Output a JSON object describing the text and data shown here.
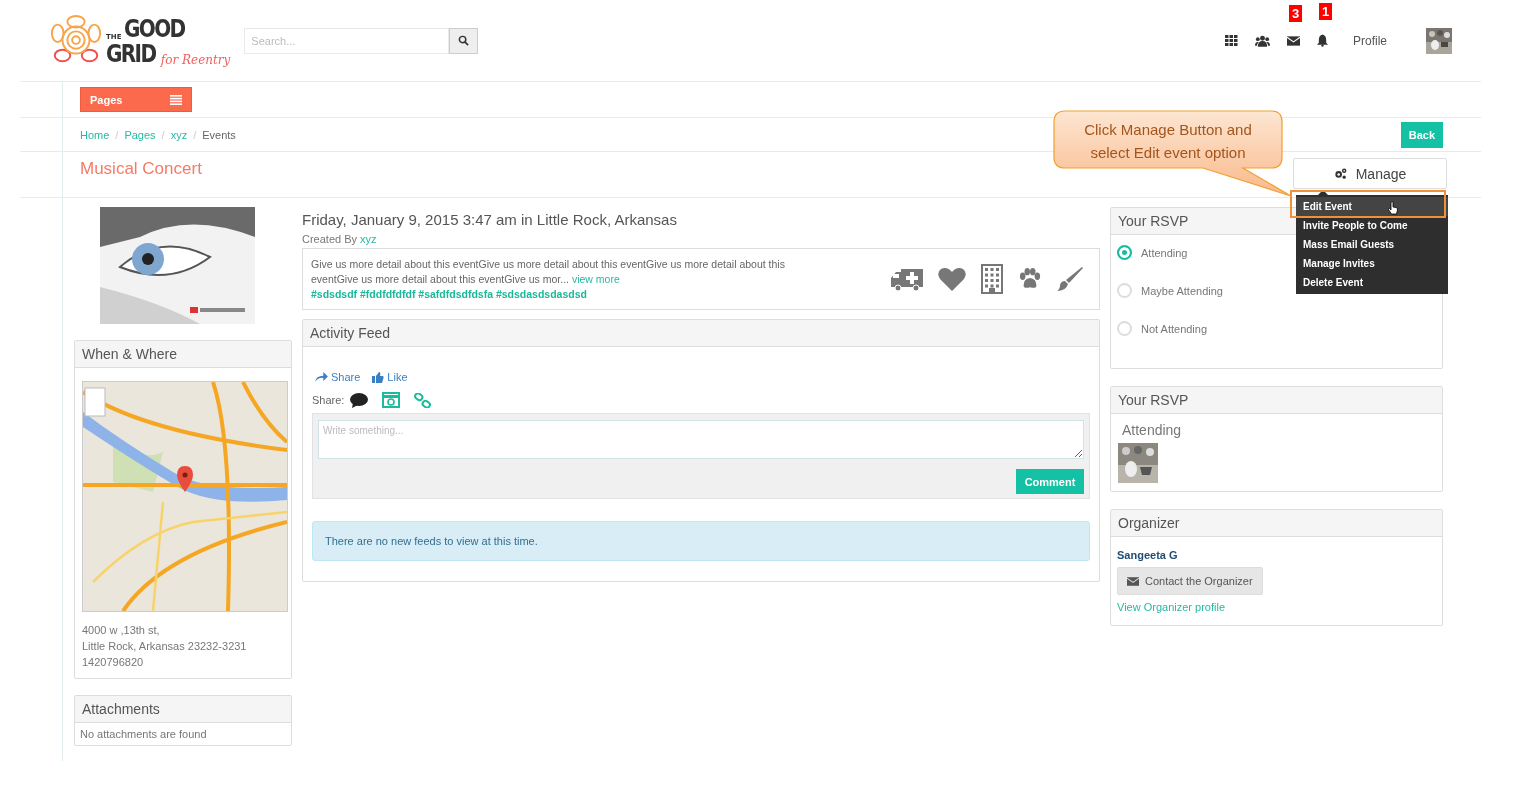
{
  "logo": {
    "the": "THE",
    "good": "GOOD",
    "grid": "GRID",
    "tagline": "for Reentry"
  },
  "search": {
    "placeholder": "Search..."
  },
  "nav_icons": [
    {
      "kind": "grid"
    },
    {
      "kind": "users"
    },
    {
      "kind": "mail",
      "badge": "3"
    },
    {
      "kind": "bell",
      "badge": "1"
    }
  ],
  "profile": {
    "label": "Profile"
  },
  "pages_button": {
    "label": "Pages"
  },
  "breadcrumb": [
    {
      "label": "Home",
      "current": false,
      "separator": "/"
    },
    {
      "label": "Pages",
      "current": false,
      "separator": "/"
    },
    {
      "label": "xyz",
      "current": false,
      "separator": "/"
    },
    {
      "label": "Events",
      "current": true
    }
  ],
  "back_button": {
    "label": "Back"
  },
  "page_title": "Musical Concert",
  "callout": {
    "text": "Click Manage Button and select Edit event option"
  },
  "manage": {
    "label": "Manage",
    "menu": [
      {
        "label": "Edit Event",
        "selected": true
      },
      {
        "label": "Invite People to Come",
        "selected": false
      },
      {
        "label": "Mass Email Guests",
        "selected": false
      },
      {
        "label": "Manage Invites",
        "selected": false
      },
      {
        "label": "Delete Event",
        "selected": false
      }
    ]
  },
  "event": {
    "datetime": "Friday, January 9, 2015 3:47 am in Little Rock, Arkansas",
    "created_by_label": "Created By",
    "creator": "xyz",
    "description": "Give us more detail about this eventGive us more detail about this eventGive us more detail about this eventGive us more detail about this eventGive us mor...",
    "view_more": "view more",
    "hashtags": "#sdsdsdf #fddfdfdfdf #safdfdsdfdsfa #sdsdasdsdasdsd"
  },
  "when_where": {
    "title": "When & Where",
    "address": [
      "4000 w ,13th st,",
      "Little Rock, Arkansas 23232-3231",
      "1420796820"
    ]
  },
  "attachments": {
    "title": "Attachments",
    "empty": "No attachments are found"
  },
  "activity_feed": {
    "title": "Activity Feed",
    "share_action": "Share",
    "like_action": "Like",
    "share_label": "Share:",
    "placeholder": "Write something...",
    "comment_button": "Comment",
    "empty": "There are no new feeds to view at this time."
  },
  "rsvp": {
    "title": "Your RSVP",
    "options": [
      {
        "label": "Attending",
        "selected": true
      },
      {
        "label": "Maybe Attending",
        "selected": false
      },
      {
        "label": "Not Attending",
        "selected": false
      }
    ]
  },
  "rsvp_summary": {
    "title": "Your RSVP",
    "status": "Attending"
  },
  "organizer": {
    "title": "Organizer",
    "name": "Sangeeta G",
    "contact_button": "Contact the Organizer",
    "profile_link": "View Organizer profile"
  }
}
